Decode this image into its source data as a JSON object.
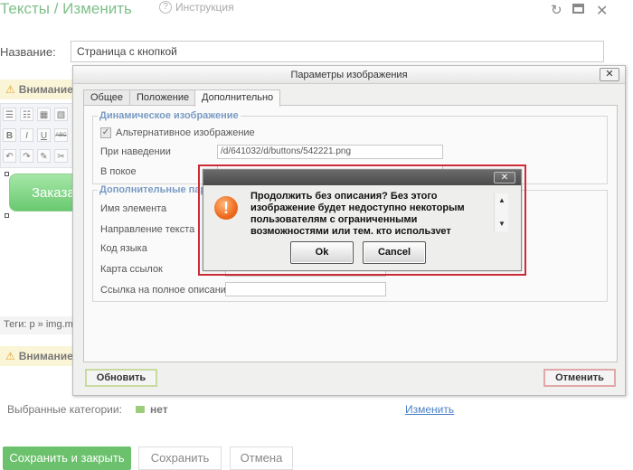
{
  "page": {
    "title": "Тексты / Изменить",
    "help": "Инструкция",
    "name_label": "Название:",
    "name_value": "Страница с кнопкой",
    "warning": "Внимание",
    "button_text": "Заказать",
    "tags": "Теги: p » img.m",
    "categories_label": "Выбранные категории:",
    "categories_value": "нет",
    "change_link": "Изменить",
    "save_close": "Сохранить и закрыть",
    "save": "Сохранить",
    "cancel": "Отмена"
  },
  "toolbar": {
    "row1": [
      "☰",
      "☷",
      "▦",
      "▧"
    ],
    "row2": [
      "B",
      "I",
      "U",
      "ABC"
    ],
    "row3": [
      "↶",
      "↷",
      "✎",
      "✂"
    ]
  },
  "image_dialog": {
    "title": "Параметры изображения",
    "close": "✕",
    "tabs": [
      "Общее",
      "Положение",
      "Дополнительно"
    ],
    "dynamic_legend": "Динамическое изображение",
    "alt_image_label": "Альтернативное изображение",
    "alt_image_checked": "✓",
    "hover_label": "При наведении",
    "hover_value": "/d/641032/d/buttons/542221.png",
    "rest_label": "В покое",
    "extra_legend": "Дополнительные пар",
    "element_name_label": "Имя элемента",
    "text_direction_label": "Направление текста",
    "lang_code_label": "Код языка",
    "image_map_label": "Карта ссылок",
    "long_desc_label": "Ссылка на полное описание",
    "refresh_button": "Обновить",
    "cancel_button": "Отменить"
  },
  "confirm_dialog": {
    "close": "✕",
    "icon": "!",
    "message": "Продолжить без описания? Без этого изображение будет недоступно некоторым пользователям с ограниченными возможностями или тем, кто использует текстовые браузеры или отключает сайты с отключенными",
    "ok": "Ok",
    "cancel": "Cancel",
    "scroll_up": "▲",
    "scroll_down": "▼"
  },
  "colors": {
    "title_green": "#7fc08a",
    "highlight_red": "#cc2a36",
    "primary_green": "#6cc16d",
    "link_blue": "#4a80c6"
  },
  "icons": [
    "help-icon",
    "refresh-icon",
    "maximize-icon",
    "close-icon",
    "warning-icon",
    "folder-icon",
    "exclamation-icon"
  ]
}
